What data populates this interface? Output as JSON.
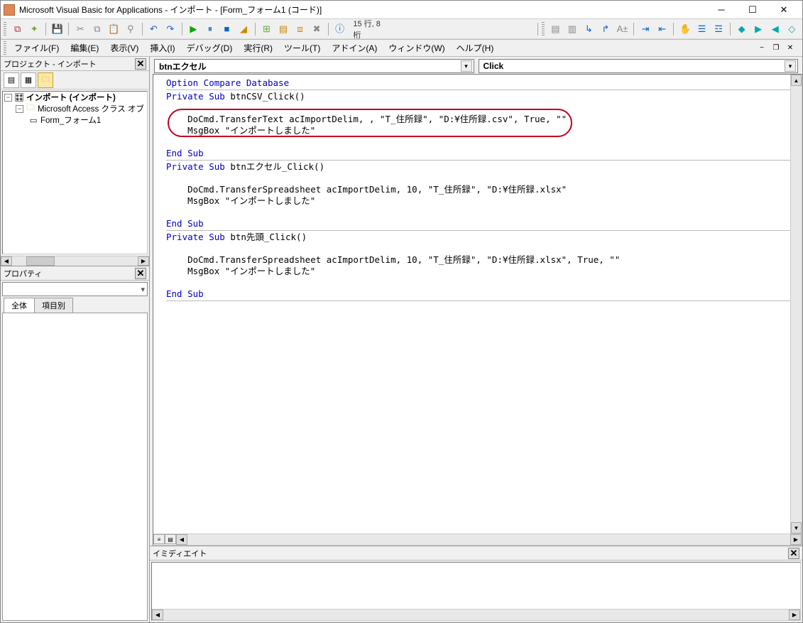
{
  "titlebar": {
    "text": "Microsoft Visual Basic for Applications - インポート - [Form_フォーム1 (コード)]"
  },
  "toolbar1": {
    "status_text": "15 行, 8 桁"
  },
  "menubar": {
    "file": "ファイル(F)",
    "edit": "編集(E)",
    "view": "表示(V)",
    "insert": "挿入(I)",
    "debug": "デバッグ(D)",
    "run": "実行(R)",
    "tools": "ツール(T)",
    "addins": "アドイン(A)",
    "window": "ウィンドウ(W)",
    "help": "ヘルプ(H)"
  },
  "project_pane": {
    "title": "プロジェクト - インポート",
    "tree": {
      "root": "インポート (インポート)",
      "group": "Microsoft Access クラス オブ",
      "item": "Form_フォーム1"
    }
  },
  "properties_pane": {
    "title": "プロパティ",
    "tab_all": "全体",
    "tab_categorized": "項目別"
  },
  "code_selectors": {
    "object": "btnエクセル",
    "procedure": "Click"
  },
  "code": {
    "line1": "Option Compare Database",
    "line2a": "Private Sub",
    "line2b": " btnCSV_Click()",
    "line3": "    DoCmd.TransferText acImportDelim, , \"T_住所録\", \"D:¥住所録.csv\", True, \"\"",
    "line4": "    MsgBox \"インポートしました\"",
    "line5": "End Sub",
    "line6a": "Private Sub",
    "line6b": " btnエクセル_Click()",
    "line7": "    DoCmd.TransferSpreadsheet acImportDelim, 10, \"T_住所録\", \"D:¥住所録.xlsx\"",
    "line8": "    MsgBox \"インポートしました\"",
    "line9": "End Sub",
    "line10a": "Private Sub",
    "line10b": " btn先頭_Click()",
    "line11": "    DoCmd.TransferSpreadsheet acImportDelim, 10, \"T_住所録\", \"D:¥住所録.xlsx\", True, \"\"",
    "line12": "    MsgBox \"インポートしました\"",
    "line13": "End Sub"
  },
  "immediate_pane": {
    "title": "イミディエイト"
  }
}
